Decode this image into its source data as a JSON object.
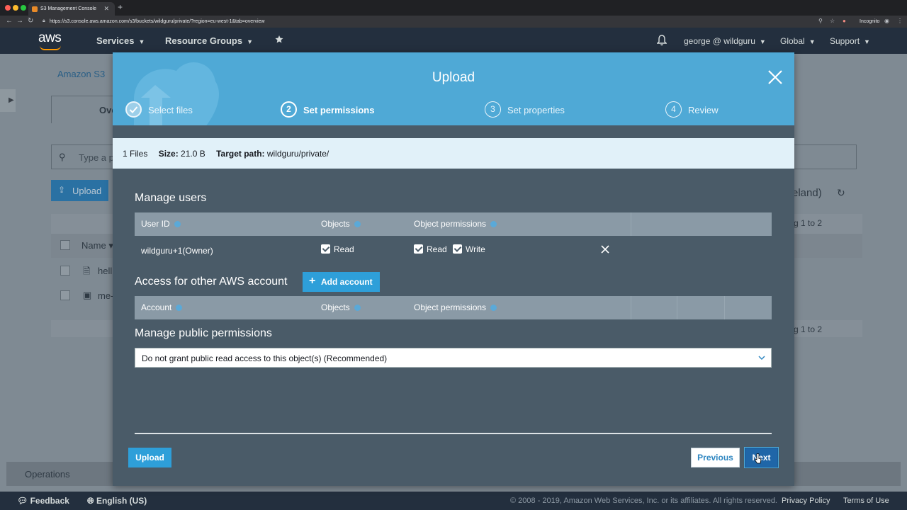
{
  "browser": {
    "tab_title": "S3 Management Console",
    "url": "https://s3.console.aws.amazon.com/s3/buckets/wildguru/private/?region=eu-west-1&tab=overview",
    "incognito_label": "Incognito"
  },
  "header": {
    "logo": "aws",
    "services": "Services",
    "resource_groups": "Resource Groups",
    "account": "george @ wildguru",
    "region": "Global",
    "support": "Support"
  },
  "background": {
    "breadcrumb": "Amazon S3",
    "overview_tab": "Ove",
    "search_placeholder": "Type a p",
    "upload_button": "Upload",
    "region_fragment": "eland)",
    "viewing_top": "g 1 to 2",
    "viewing_bottom": "g 1 to 2",
    "name_header": "Name",
    "file_rows": [
      "hell",
      "me-"
    ],
    "operations": "Operations"
  },
  "modal": {
    "title": "Upload",
    "steps": [
      {
        "number": "1",
        "label": "Select files",
        "state": "done"
      },
      {
        "number": "2",
        "label": "Set permissions",
        "state": "active"
      },
      {
        "number": "3",
        "label": "Set properties",
        "state": "pending"
      },
      {
        "number": "4",
        "label": "Review",
        "state": "pending"
      }
    ],
    "info": {
      "files": "1 Files",
      "size_label": "Size:",
      "size_value": "21.0 B",
      "target_label": "Target path:",
      "target_value": "wildguru/private/"
    },
    "manage_users": {
      "title": "Manage users",
      "columns": [
        "User ID",
        "Objects",
        "Object permissions"
      ],
      "rows": [
        {
          "user_id": "wildguru+1(Owner)",
          "objects_read": "Read",
          "perm_read": "Read",
          "perm_write": "Write"
        }
      ]
    },
    "other_accounts": {
      "title": "Access for other AWS account",
      "add_button": "Add account",
      "columns": [
        "Account",
        "Objects",
        "Object permissions"
      ]
    },
    "public": {
      "title": "Manage public permissions",
      "selected": "Do not grant public read access to this object(s) (Recommended)"
    },
    "buttons": {
      "upload": "Upload",
      "previous": "Previous",
      "next": "Next"
    }
  },
  "footer": {
    "feedback": "Feedback",
    "language": "English (US)",
    "copyright": "© 2008 - 2019, Amazon Web Services, Inc. or its affiliates. All rights reserved.",
    "privacy": "Privacy Policy",
    "terms": "Terms of Use"
  },
  "colors": {
    "header_bg": "#232f3e",
    "modal_header": "#4fa9d6",
    "modal_body": "#4a5b68",
    "primary_button": "#2e9fd9",
    "accent_orange": "#ff9900"
  }
}
